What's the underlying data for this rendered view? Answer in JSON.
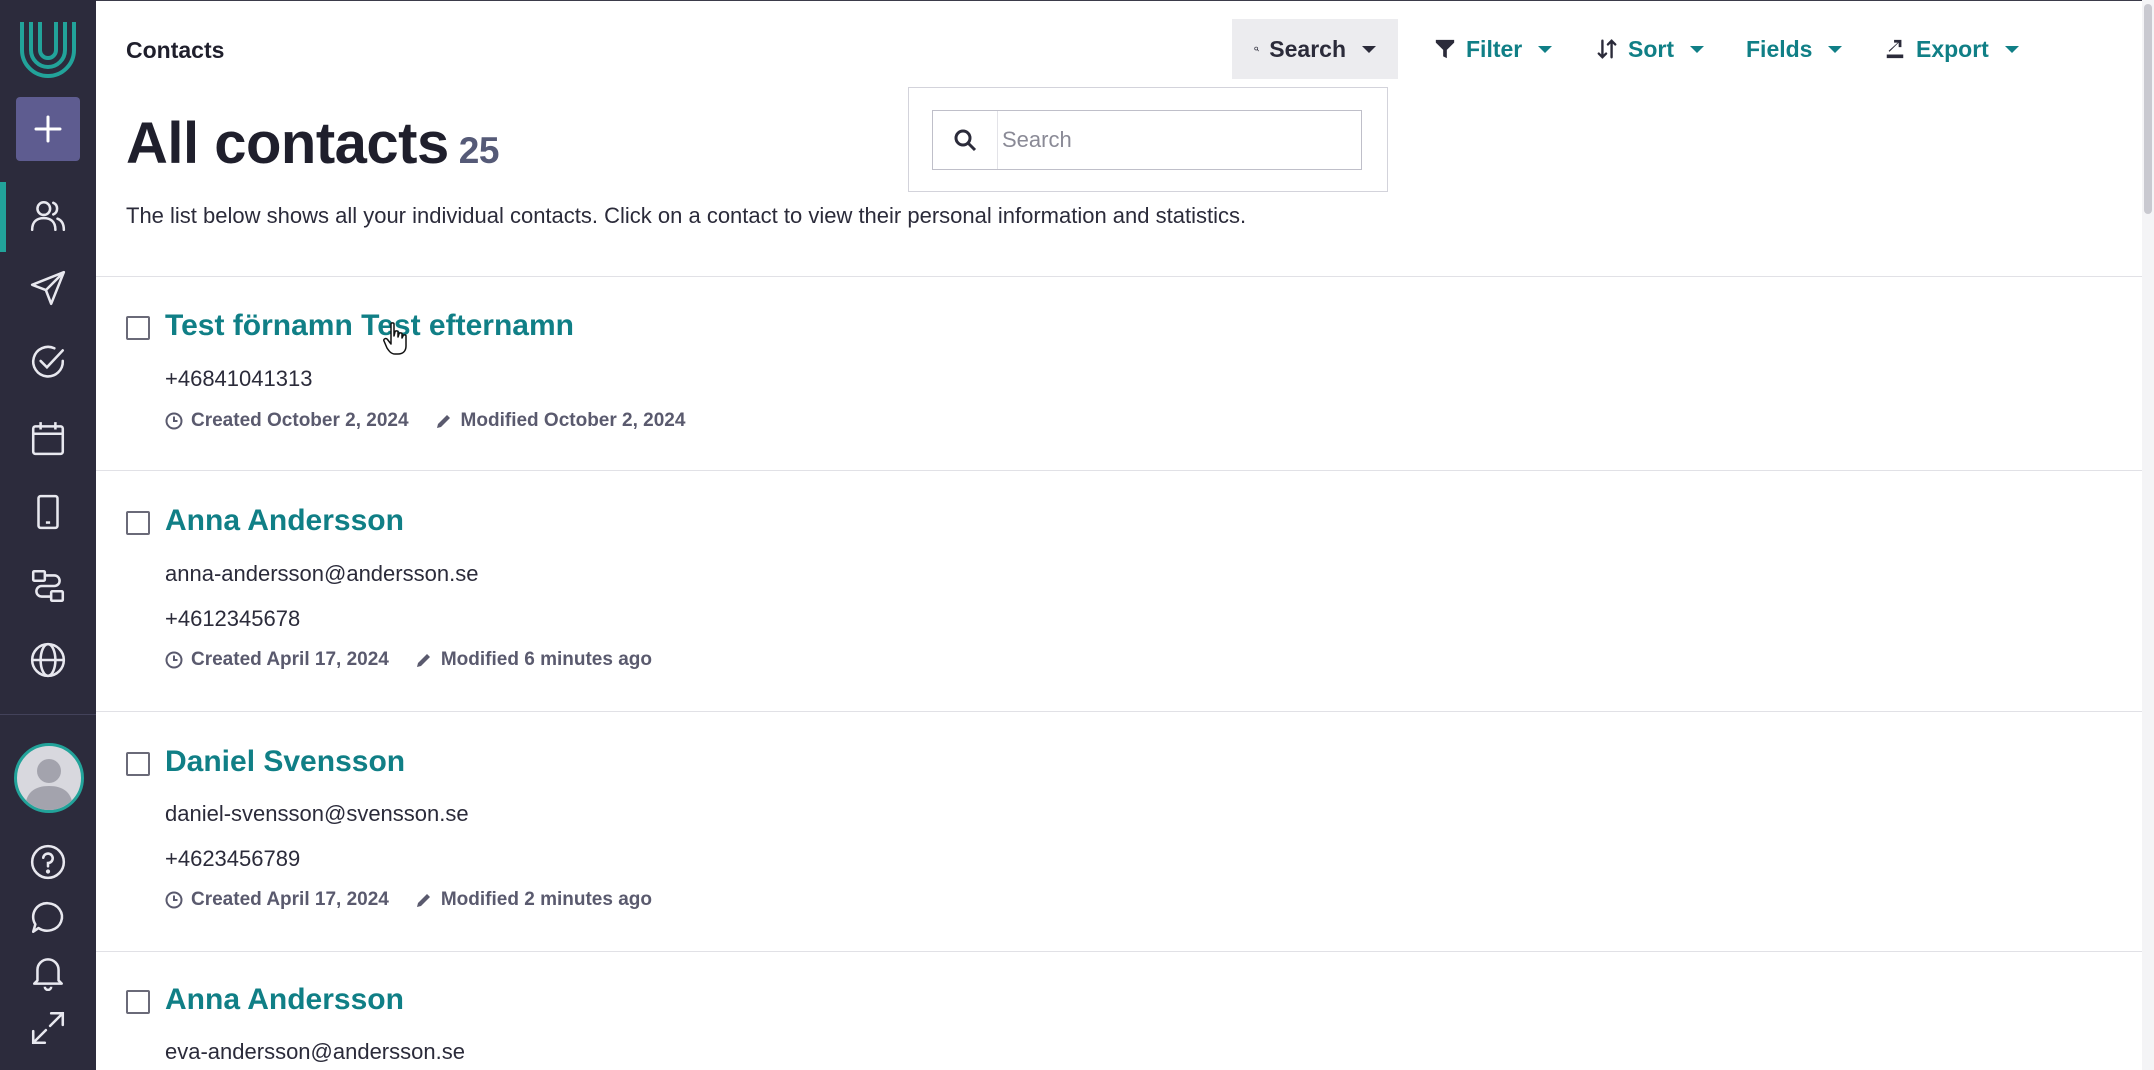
{
  "app": {
    "breadcrumb": "Contacts"
  },
  "toolbar": {
    "search_label": "Search",
    "filter_label": "Filter",
    "sort_label": "Sort",
    "fields_label": "Fields",
    "export_label": "Export"
  },
  "search_popup": {
    "placeholder": "Search",
    "value": ""
  },
  "page": {
    "title": "All contacts",
    "count": "25",
    "description": "The list below shows all your individual contacts. Click on a contact to view their personal information and statistics."
  },
  "contacts": [
    {
      "name": "Test förnamn Test efternamn",
      "email": "",
      "phone": "+46841041313",
      "created": "Created October 2, 2024",
      "modified": "Modified October 2, 2024"
    },
    {
      "name": "Anna Andersson",
      "email": "anna-andersson@andersson.se",
      "phone": "+4612345678",
      "created": "Created April 17, 2024",
      "modified": "Modified 6 minutes ago"
    },
    {
      "name": "Daniel Svensson",
      "email": "daniel-svensson@svensson.se",
      "phone": "+4623456789",
      "created": "Created April 17, 2024",
      "modified": "Modified 2 minutes ago"
    },
    {
      "name": "Anna Andersson",
      "email": "eva-andersson@andersson.se",
      "phone": "",
      "created": "",
      "modified": ""
    }
  ],
  "sidebar": {
    "items": [
      "contacts-icon",
      "send-icon",
      "check-circle-icon",
      "calendar-icon",
      "mobile-icon",
      "workflow-icon",
      "globe-icon"
    ],
    "bottom_items": [
      "help-icon",
      "chat-icon",
      "bell-icon",
      "expand-icon"
    ]
  },
  "colors": {
    "sidebar_bg": "#2c2b3c",
    "accent_teal": "#107f86",
    "active_bar": "#22a39a",
    "add_button": "#5e5c90"
  }
}
